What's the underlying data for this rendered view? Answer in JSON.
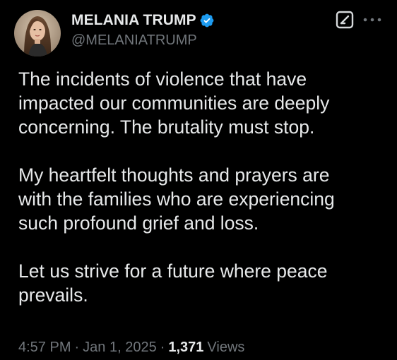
{
  "colors": {
    "background": "#000000",
    "text_primary": "#e7e9ea",
    "text_secondary": "#71767b",
    "verified_badge": "#1d9bf0"
  },
  "author": {
    "display_name": "MELANIA TRUMP",
    "handle": "@MELANIATRUMP",
    "verified": true,
    "avatar_icon": "profile-photo"
  },
  "header_actions": {
    "grok_icon": "grok-icon",
    "more_icon": "more-dots-icon"
  },
  "tweet": {
    "paragraphs": [
      "The incidents of violence that have\nimpacted our communities are deeply\nconcerning. The brutality must stop.",
      "My heartfelt thoughts and prayers are\nwith the families who are experiencing\nsuch profound grief and loss.",
      "Let us strive for a future where peace\nprevails."
    ]
  },
  "meta": {
    "time": "4:57 PM",
    "separator": "·",
    "date": "Jan 1, 2025",
    "views_count": "1,371",
    "views_label": "Views"
  }
}
